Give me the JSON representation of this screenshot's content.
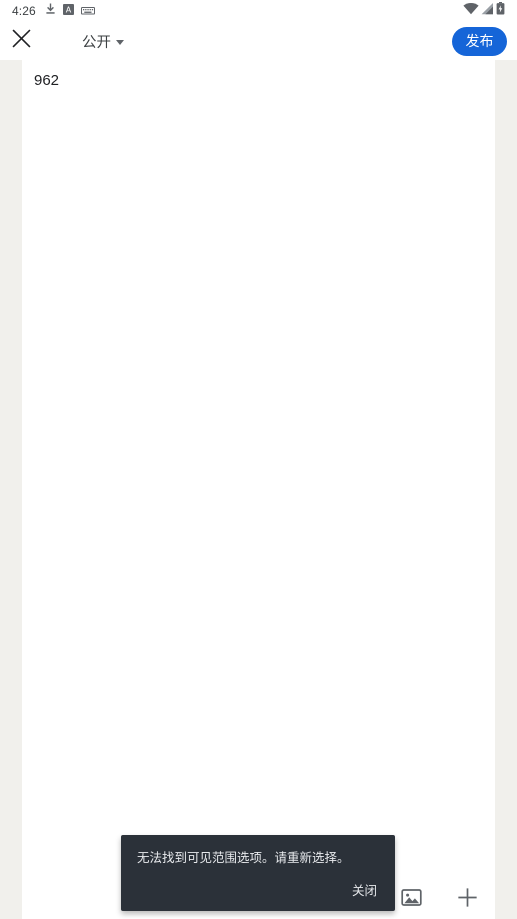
{
  "status_bar": {
    "time": "4:26",
    "left_icons": [
      {
        "name": "download-icon",
        "glyph": "download"
      },
      {
        "name": "app-badge-a-icon",
        "glyph": "A"
      },
      {
        "name": "keyboard-icon",
        "glyph": "keyboard"
      }
    ],
    "right_icons": [
      {
        "name": "wifi-icon",
        "glyph": "wifi"
      },
      {
        "name": "cellular-signal-icon",
        "glyph": "signal"
      },
      {
        "name": "battery-charging-icon",
        "glyph": "battery"
      }
    ]
  },
  "app_bar": {
    "close_label": "×",
    "visibility_label": "公开",
    "publish_label": "发布",
    "accent_color": "#1565d8"
  },
  "editor": {
    "body_text": "962",
    "page_background": "#ffffff",
    "canvas_background": "#f1f0ec"
  },
  "bottom_bar": {
    "buttons": [
      {
        "name": "insert-image-button",
        "label": "image-icon"
      },
      {
        "name": "add-more-button",
        "label": "plus-icon"
      }
    ]
  },
  "snackbar": {
    "message": "无法找到可见范围选项。请重新选择。",
    "action_label": "关闭",
    "background_color": "#2b3139",
    "text_color": "#e8eaed"
  }
}
